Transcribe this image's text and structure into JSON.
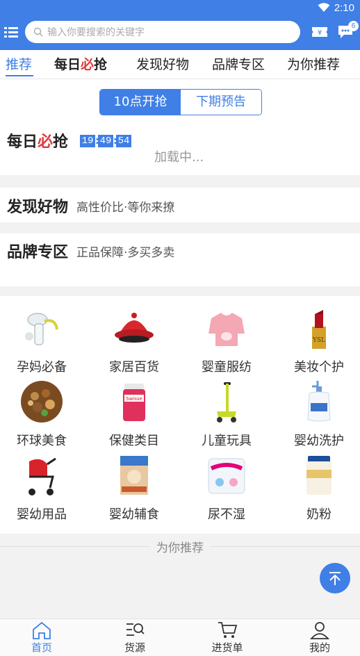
{
  "status": {
    "time": "2:10"
  },
  "search": {
    "placeholder": "输入你要搜索的关键字"
  },
  "chat": {
    "badge": "6"
  },
  "tabs": [
    {
      "label": "推荐",
      "active": true
    },
    {
      "label": "每日必抢",
      "active": false
    },
    {
      "label": "发现好物",
      "active": false
    },
    {
      "label": "品牌专区",
      "active": false
    },
    {
      "label": "为你推荐",
      "active": false
    }
  ],
  "tab_special": {
    "part1": "每日",
    "part2": "必",
    "part3": "抢"
  },
  "daily": {
    "toggle_on": "10点开抢",
    "toggle_off": "下期预告",
    "title_a": "每日",
    "title_b": "必",
    "title_c": "抢",
    "countdown": {
      "h": "19",
      "m": "49",
      "s": "54",
      "sep": ":"
    },
    "loading": "加载中..."
  },
  "discover": {
    "title": "发现好物",
    "subtitle": "高性价比·等你来撩"
  },
  "brand": {
    "title": "品牌专区",
    "subtitle": "正品保障·多买多卖"
  },
  "categories": [
    {
      "label": "孕妈必备",
      "icon": "breast-pump-icon"
    },
    {
      "label": "家居百货",
      "icon": "tagine-pot-icon"
    },
    {
      "label": "婴童服纺",
      "icon": "baby-bib-icon"
    },
    {
      "label": "美妆个护",
      "icon": "lipstick-icon"
    },
    {
      "label": "环球美食",
      "icon": "nuts-bowl-icon"
    },
    {
      "label": "保健类目",
      "icon": "supplement-bottle-icon"
    },
    {
      "label": "儿童玩具",
      "icon": "scooter-icon"
    },
    {
      "label": "婴幼洗护",
      "icon": "lotion-bottle-icon"
    },
    {
      "label": "婴幼用品",
      "icon": "stroller-icon"
    },
    {
      "label": "婴幼辅食",
      "icon": "cereal-box-icon"
    },
    {
      "label": "尿不湿",
      "icon": "diaper-pack-icon"
    },
    {
      "label": "奶粉",
      "icon": "milk-powder-can-icon"
    }
  ],
  "recommend": {
    "label": "为你推荐"
  },
  "nav": [
    {
      "label": "首页",
      "icon": "home-icon",
      "active": true
    },
    {
      "label": "货源",
      "icon": "source-search-icon",
      "active": false
    },
    {
      "label": "进货单",
      "icon": "cart-icon",
      "active": false
    },
    {
      "label": "我的",
      "icon": "profile-icon",
      "active": false
    }
  ],
  "colors": {
    "accent": "#3f7fe6",
    "highlight": "#e23a3a",
    "background": "#f2f2f2"
  }
}
